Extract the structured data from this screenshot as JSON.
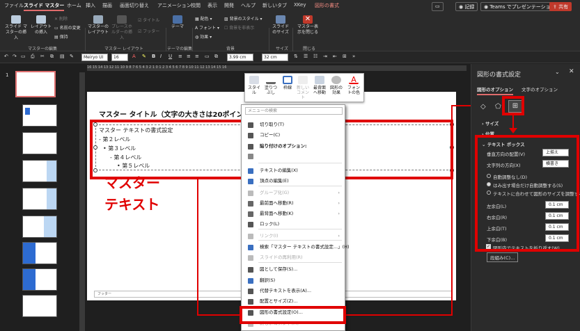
{
  "tabs": [
    "ファイル",
    "スライド マスター",
    "ホーム",
    "挿入",
    "描画",
    "画面切り替え",
    "アニメーション",
    "校閲",
    "表示",
    "開発",
    "ヘルプ",
    "新しいタブ",
    "XKey",
    "図形の書式"
  ],
  "topbar": {
    "record": "記録",
    "teams": "Teams でプレゼンテーション",
    "share": "共有"
  },
  "ribbon": {
    "insert_master": "スライド マスターの挿入",
    "insert_layout": "レイアウトの挿入",
    "delete": "削除",
    "rename": "名前の変更",
    "preserve": "保持",
    "master_layout": "マスターのレイアウト",
    "insert_placeholder": "プレースホルダーの挿入",
    "title": "タイトル",
    "footer": "フッター",
    "theme": "テーマ",
    "colors": "配色",
    "fonts": "フォント",
    "effects": "効果",
    "bg_styles": "背景のスタイル",
    "hide_bg": "背景を非表示",
    "slide_size": "スライドのサイズ",
    "close_master": "マスター表示を閉じる",
    "groups": [
      "マスターの編集",
      "マスター レイアウト",
      "テーマの編集",
      "背景",
      "サイズ",
      "閉じる"
    ]
  },
  "format_bar": {
    "font": "Meiryo UI",
    "size": "16",
    "width": "3.99 cm",
    "height": "32 cm"
  },
  "ruler": "16 15 14 13 12 11 10 9 8 7 6 5 4 3 2 1 0 1 2 3 4 5 6 7 8 9 10 11 12 13 14 15 16",
  "thumb_numbers": [
    "1"
  ],
  "slide": {
    "title": "マスター タイトル（文字の大きさは20ポイント、",
    "levels": [
      "マスター テキストの書式設定",
      "- 第２レベル",
      "• 第３レベル",
      "- 第４レベル",
      "• 第５レベル"
    ],
    "footer": "フッター",
    "annotation_line1": "マスター",
    "annotation_line2": "テキスト"
  },
  "minitoolbar": [
    "スタイル",
    "塗りつぶし",
    "枠線",
    "新しいコメント",
    "最背面へ移動",
    "図形の効果",
    "フォントの色"
  ],
  "context_menu": {
    "search": "メニューの検索",
    "items": [
      {
        "label": "切り取り(T)",
        "icon": "scissors-icon",
        "color": "#555"
      },
      {
        "label": "コピー(C)",
        "icon": "copy-icon",
        "color": "#555"
      },
      {
        "label": "貼り付けのオプション:",
        "icon": "paste-icon",
        "color": "#555",
        "bold": true
      },
      {
        "label": "",
        "icon": "paste-options-icon",
        "color": "#888"
      },
      {
        "label": "テキストの編集(X)",
        "icon": "text-edit-icon",
        "color": "#3a6fc0"
      },
      {
        "label": "頂点の編集(E)",
        "icon": "edit-points-icon",
        "color": "#3a6fc0"
      },
      {
        "label": "グループ化(G)",
        "icon": "group-icon",
        "color": "#bbb",
        "dim": true,
        "arrow": true
      },
      {
        "label": "最前面へ移動(R)",
        "icon": "bring-front-icon",
        "color": "#666",
        "arrow": true
      },
      {
        "label": "最背面へ移動(K)",
        "icon": "send-back-icon",
        "color": "#666",
        "arrow": true
      },
      {
        "label": "ロック(L)",
        "icon": "lock-icon",
        "color": "#555"
      },
      {
        "label": "リンク(I)",
        "icon": "link-icon",
        "color": "#bbb",
        "dim": true,
        "arrow": true
      },
      {
        "label": "検索「マスター テキストの書式設定...」(H)",
        "icon": "search-icon",
        "color": "#3a6fc0"
      },
      {
        "label": "スライドの再利用(R)",
        "icon": "reuse-icon",
        "color": "#bbb",
        "dim": true
      },
      {
        "label": "図として保存(S)...",
        "icon": "save-picture-icon",
        "color": "#555"
      },
      {
        "label": "翻訳(S)",
        "icon": "translate-icon",
        "color": "#3a6fc0"
      },
      {
        "label": "代替テキストを表示(A)...",
        "icon": "alt-text-icon",
        "color": "#555"
      },
      {
        "label": "配置とサイズ(Z)...",
        "icon": "size-position-icon",
        "color": "#555"
      },
      {
        "label": "図形の書式設定(O)...",
        "icon": "format-shape-icon",
        "color": "#555"
      },
      {
        "label": "新しいコメント(M)",
        "icon": "comment-icon",
        "color": "#bbb",
        "dim": true
      }
    ]
  },
  "pane": {
    "title": "図形の書式設定",
    "tab_shape": "図形のオプション",
    "tab_text": "文字のオプション",
    "size": "サイズ",
    "position": "位置",
    "textbox": "テキスト ボックス",
    "valign_label": "垂直方向の配置(V)",
    "valign_value": "上揃え",
    "dir_label": "文字列の方向(X)",
    "dir_value": "横書き",
    "radio1": "自動調整なし(D)",
    "radio2": "はみ出す場合だけ自動調整する(S)",
    "radio3": "テキストに合わせて図形のサイズを調整する",
    "margin_left": "左余白(L)",
    "margin_right": "右余白(R)",
    "margin_top": "上余白(T)",
    "margin_bottom": "下余白(B)",
    "margin_value": "0.1 cm",
    "wrap": "図形内でテキストを折り返す(W)",
    "columns": "段組み(C)..."
  }
}
